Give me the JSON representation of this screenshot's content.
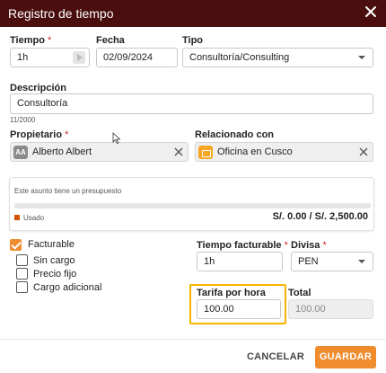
{
  "window": {
    "title": "Registro de tiempo"
  },
  "tiempo": {
    "label": "Tiempo",
    "required_mark": "*",
    "value": "1h"
  },
  "fecha": {
    "label": "Fecha",
    "value": "02/09/2024"
  },
  "tipo": {
    "label": "Tipo",
    "value": "Consultoría/Consulting"
  },
  "descripcion": {
    "label": "Descripción",
    "value": "Consultoría",
    "counter": "11/2000"
  },
  "propietario": {
    "label": "Propietario",
    "required_mark": "*",
    "value": "Alberto Albert",
    "avatar_initials": "AA"
  },
  "relacionado": {
    "label": "Relacionado con",
    "value": "Oficina en Cusco"
  },
  "budget": {
    "note": "Este asunto tiene un presupuesto",
    "legend": "Usado",
    "amount": "S/. 0.00 / S/. 2,500.00",
    "used_fraction": 0,
    "fill_color": "#d35400"
  },
  "checkboxes": {
    "facturable": {
      "label": "Facturable",
      "checked": true
    },
    "sin_cargo": {
      "label": "Sin cargo",
      "checked": false
    },
    "precio_fijo": {
      "label": "Precio fijo",
      "checked": false
    },
    "cargo_adicional": {
      "label": "Cargo adicional",
      "checked": false
    }
  },
  "tiempo_facturable": {
    "label": "Tiempo facturable",
    "required_mark": "*",
    "value": "1h"
  },
  "divisa": {
    "label": "Divisa",
    "required_mark": "*",
    "value": "PEN"
  },
  "tarifa": {
    "label": "Tarifa por hora",
    "value": "100.00"
  },
  "total": {
    "label": "Total",
    "value": "100.00"
  },
  "actions": {
    "cancel": "CANCELAR",
    "save": "GUARDAR"
  },
  "colors": {
    "titlebar": "#4a0e0e",
    "accent": "#f08c2e",
    "highlight": "#f5b400",
    "required": "#c62828"
  },
  "icons": [
    "close-icon",
    "play-icon",
    "chevron-down-icon",
    "avatar",
    "office-icon",
    "clear-icon",
    "check-icon"
  ]
}
